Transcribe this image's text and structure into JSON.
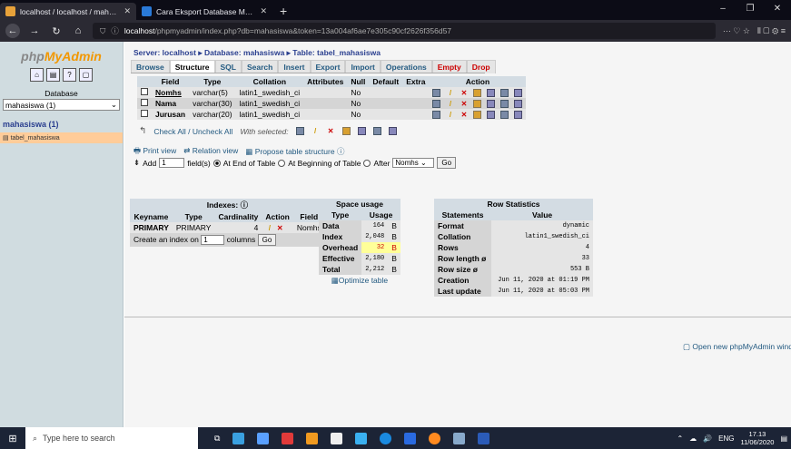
{
  "browser": {
    "tabs": [
      {
        "title": "localhost / localhost / mahasis",
        "active": true
      },
      {
        "title": "Cara Eksport Database MySQL",
        "active": false
      }
    ],
    "url_prefix": "ⓘ",
    "url_host": "localhost",
    "url_rest": "/phpmyadmin/index.php?db=mahasiswa&token=13a004af6ae7e305c90cf2626f356d57",
    "url_right_icons": "··· ♡ ☆"
  },
  "sidebar": {
    "logo_a": "php",
    "logo_b": "MyAdmin",
    "database_label": "Database",
    "database_selected": "mahasiswa (1)",
    "db_link": "mahasiswa (1)",
    "table_link": "tabel_mahasiswa"
  },
  "breadcrumb": "Server: localhost ▸ Database: mahasiswa ▸ Table: tabel_mahasiswa",
  "tabs": [
    "Browse",
    "Structure",
    "SQL",
    "Search",
    "Insert",
    "Export",
    "Import",
    "Operations",
    "Empty",
    "Drop"
  ],
  "structure": {
    "headers": [
      "Field",
      "Type",
      "Collation",
      "Attributes",
      "Null",
      "Default",
      "Extra",
      "Action"
    ],
    "rows": [
      {
        "field": "Nomhs",
        "type": "varchar(5)",
        "collation": "latin1_swedish_ci",
        "attributes": "",
        "null": "No",
        "default": "",
        "extra": ""
      },
      {
        "field": "Nama",
        "type": "varchar(30)",
        "collation": "latin1_swedish_ci",
        "attributes": "",
        "null": "No",
        "default": "",
        "extra": ""
      },
      {
        "field": "Jurusan",
        "type": "varchar(20)",
        "collation": "latin1_swedish_ci",
        "attributes": "",
        "null": "No",
        "default": "",
        "extra": ""
      }
    ],
    "check_all": "Check All / Uncheck All",
    "with_selected": "With selected:"
  },
  "links": {
    "print_view": "Print view",
    "relation_view": "Relation view",
    "propose": "Propose table structure"
  },
  "add_field": {
    "label": "Add",
    "count": "1",
    "fields_text": "field(s)",
    "at_end": "At End of Table",
    "at_beginning": "At Beginning of Table",
    "after": "After",
    "after_field": "Nomhs",
    "go": "Go"
  },
  "indexes": {
    "title": "Indexes:",
    "headers": [
      "Keyname",
      "Type",
      "Cardinality",
      "Action",
      "Field"
    ],
    "row": {
      "keyname": "PRIMARY",
      "type": "PRIMARY",
      "cardinality": "4",
      "field": "Nomhs"
    },
    "create_text": "Create an index on",
    "create_count": "1",
    "columns_text": "columns",
    "go": "Go"
  },
  "space": {
    "title": "Space usage",
    "headers": [
      "Type",
      "Usage"
    ],
    "rows": [
      {
        "type": "Data",
        "usage": "164",
        "unit": "B"
      },
      {
        "type": "Index",
        "usage": "2,048",
        "unit": "B"
      },
      {
        "type": "Overhead",
        "usage": "32",
        "unit": "B"
      },
      {
        "type": "Effective",
        "usage": "2,180",
        "unit": "B"
      },
      {
        "type": "Total",
        "usage": "2,212",
        "unit": "B"
      }
    ],
    "optimize": "Optimize table"
  },
  "rowstats": {
    "title": "Row Statistics",
    "headers": [
      "Statements",
      "Value"
    ],
    "rows": [
      {
        "s": "Format",
        "v": "dynamic"
      },
      {
        "s": "Collation",
        "v": "latin1_swedish_ci"
      },
      {
        "s": "Rows",
        "v": "4"
      },
      {
        "s": "Row length ø",
        "v": "33"
      },
      {
        "s": "Row size ø",
        "v": "553 B"
      },
      {
        "s": "Creation",
        "v": "Jun 11, 2020 at 01:19 PM"
      },
      {
        "s": "Last update",
        "v": "Jun 11, 2020 at 05:03 PM"
      }
    ]
  },
  "new_window": "Open new phpMyAdmin windo",
  "taskbar": {
    "search_placeholder": "Type here to search",
    "lang": "ENG",
    "time": "17.13",
    "date": "11/06/2020"
  },
  "colors": {
    "accent": "#235a81",
    "sidebar_bg": "#d0dce0",
    "header_bg": "#d3dce3"
  }
}
